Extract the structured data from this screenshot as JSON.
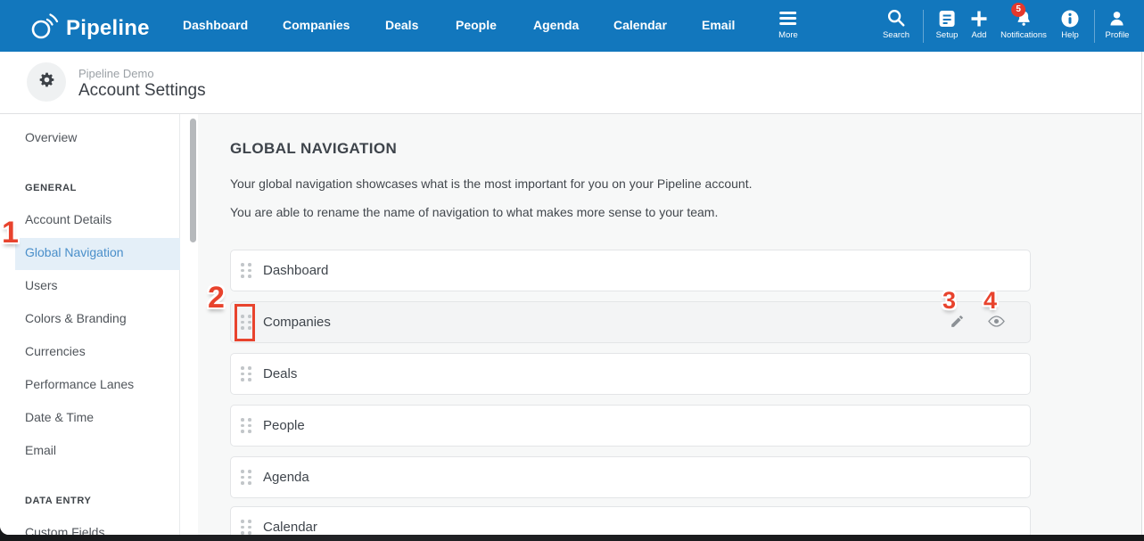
{
  "navbar": {
    "logo_text": "Pipeline",
    "items": [
      "Dashboard",
      "Companies",
      "Deals",
      "People",
      "Agenda",
      "Calendar",
      "Email"
    ],
    "more_label": "More",
    "actions": [
      {
        "label": "Search"
      },
      {
        "label": "Setup"
      },
      {
        "label": "Add"
      },
      {
        "label": "Notifications",
        "badge": "5"
      },
      {
        "label": "Help"
      },
      {
        "label": "Profile"
      }
    ],
    "colors": {
      "background": "#1277BD",
      "badge": "#E5382C"
    }
  },
  "header": {
    "subtitle": "Pipeline Demo",
    "title": "Account Settings"
  },
  "sidebar": {
    "items": [
      {
        "label": "Overview",
        "type": "item"
      },
      {
        "label": "GENERAL",
        "type": "section"
      },
      {
        "label": "Account Details",
        "type": "item"
      },
      {
        "label": "Global Navigation",
        "type": "item",
        "selected": true
      },
      {
        "label": "Users",
        "type": "item"
      },
      {
        "label": "Colors & Branding",
        "type": "item"
      },
      {
        "label": "Currencies",
        "type": "item"
      },
      {
        "label": "Performance Lanes",
        "type": "item"
      },
      {
        "label": "Date & Time",
        "type": "item"
      },
      {
        "label": "Email",
        "type": "item"
      },
      {
        "label": "DATA ENTRY",
        "type": "section"
      },
      {
        "label": "Custom Fields",
        "type": "item"
      }
    ],
    "selected_color": "#4A8FCA",
    "selected_bg": "#E4EFF8"
  },
  "main": {
    "heading": "GLOBAL NAVIGATION",
    "paragraphs": [
      "Your global navigation showcases what is the most important for you on your Pipeline account.",
      "You are able to rename the name of navigation to what makes more sense to your team."
    ],
    "rows": [
      {
        "label": "Dashboard"
      },
      {
        "label": "Companies",
        "hovered": true,
        "actions": [
          "edit",
          "visibility"
        ]
      },
      {
        "label": "Deals"
      },
      {
        "label": "People"
      },
      {
        "label": "Agenda"
      },
      {
        "label": "Calendar"
      }
    ]
  },
  "annotations": {
    "callouts": [
      "1",
      "2",
      "3",
      "4"
    ],
    "color": "#E8432D"
  }
}
